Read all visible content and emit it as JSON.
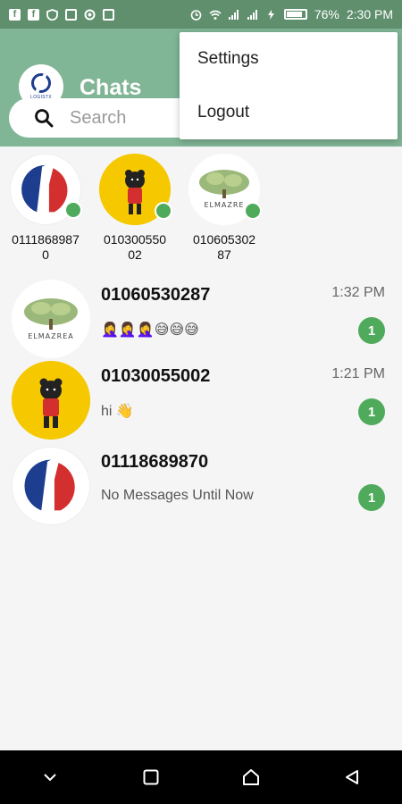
{
  "status_bar": {
    "battery": "76%",
    "time": "2:30 PM",
    "left_icons": [
      "facebook-icon",
      "facebook-icon",
      "shield-icon",
      "phone-icon",
      "circle-icon",
      "store-icon"
    ],
    "right_icons": [
      "alarm-icon",
      "wifi-icon",
      "signal-icon",
      "signal-icon",
      "charging-icon",
      "battery-icon"
    ]
  },
  "header": {
    "title": "Chats",
    "logo_text": "LOGISTX",
    "search_placeholder": "Search"
  },
  "menu": {
    "items": [
      {
        "label": "Settings"
      },
      {
        "label": "Logout"
      }
    ]
  },
  "online": [
    {
      "name": "01118689870",
      "avatar": "brand-logo"
    },
    {
      "name": "01030055002",
      "avatar": "bear-character"
    },
    {
      "name": "01060530287",
      "avatar": "money-tree"
    }
  ],
  "chats": [
    {
      "name": "01060530287",
      "time": "1:32 PM",
      "preview": "🤦‍♀️🤦‍♀️🤦‍♀️😅😅😅",
      "unread": "1",
      "avatar": "money-tree"
    },
    {
      "name": "01030055002",
      "time": "1:21 PM",
      "preview": "hi 👋",
      "unread": "1",
      "avatar": "bear-character"
    },
    {
      "name": "01118689870",
      "time": "",
      "preview": "No Messages Until Now",
      "unread": "1",
      "avatar": "brand-logo"
    }
  ],
  "colors": {
    "header": "#80b596",
    "status_bar": "#5f8f6d",
    "badge": "#4fab5b",
    "online_dot": "#4fab5b",
    "brand_blue": "#1d3d8f",
    "brand_red": "#d32f2f",
    "bear_bg": "#f5c800"
  },
  "nav": {
    "buttons": [
      "chevron-down-icon",
      "recents-square-icon",
      "home-icon",
      "back-triangle-icon"
    ]
  }
}
